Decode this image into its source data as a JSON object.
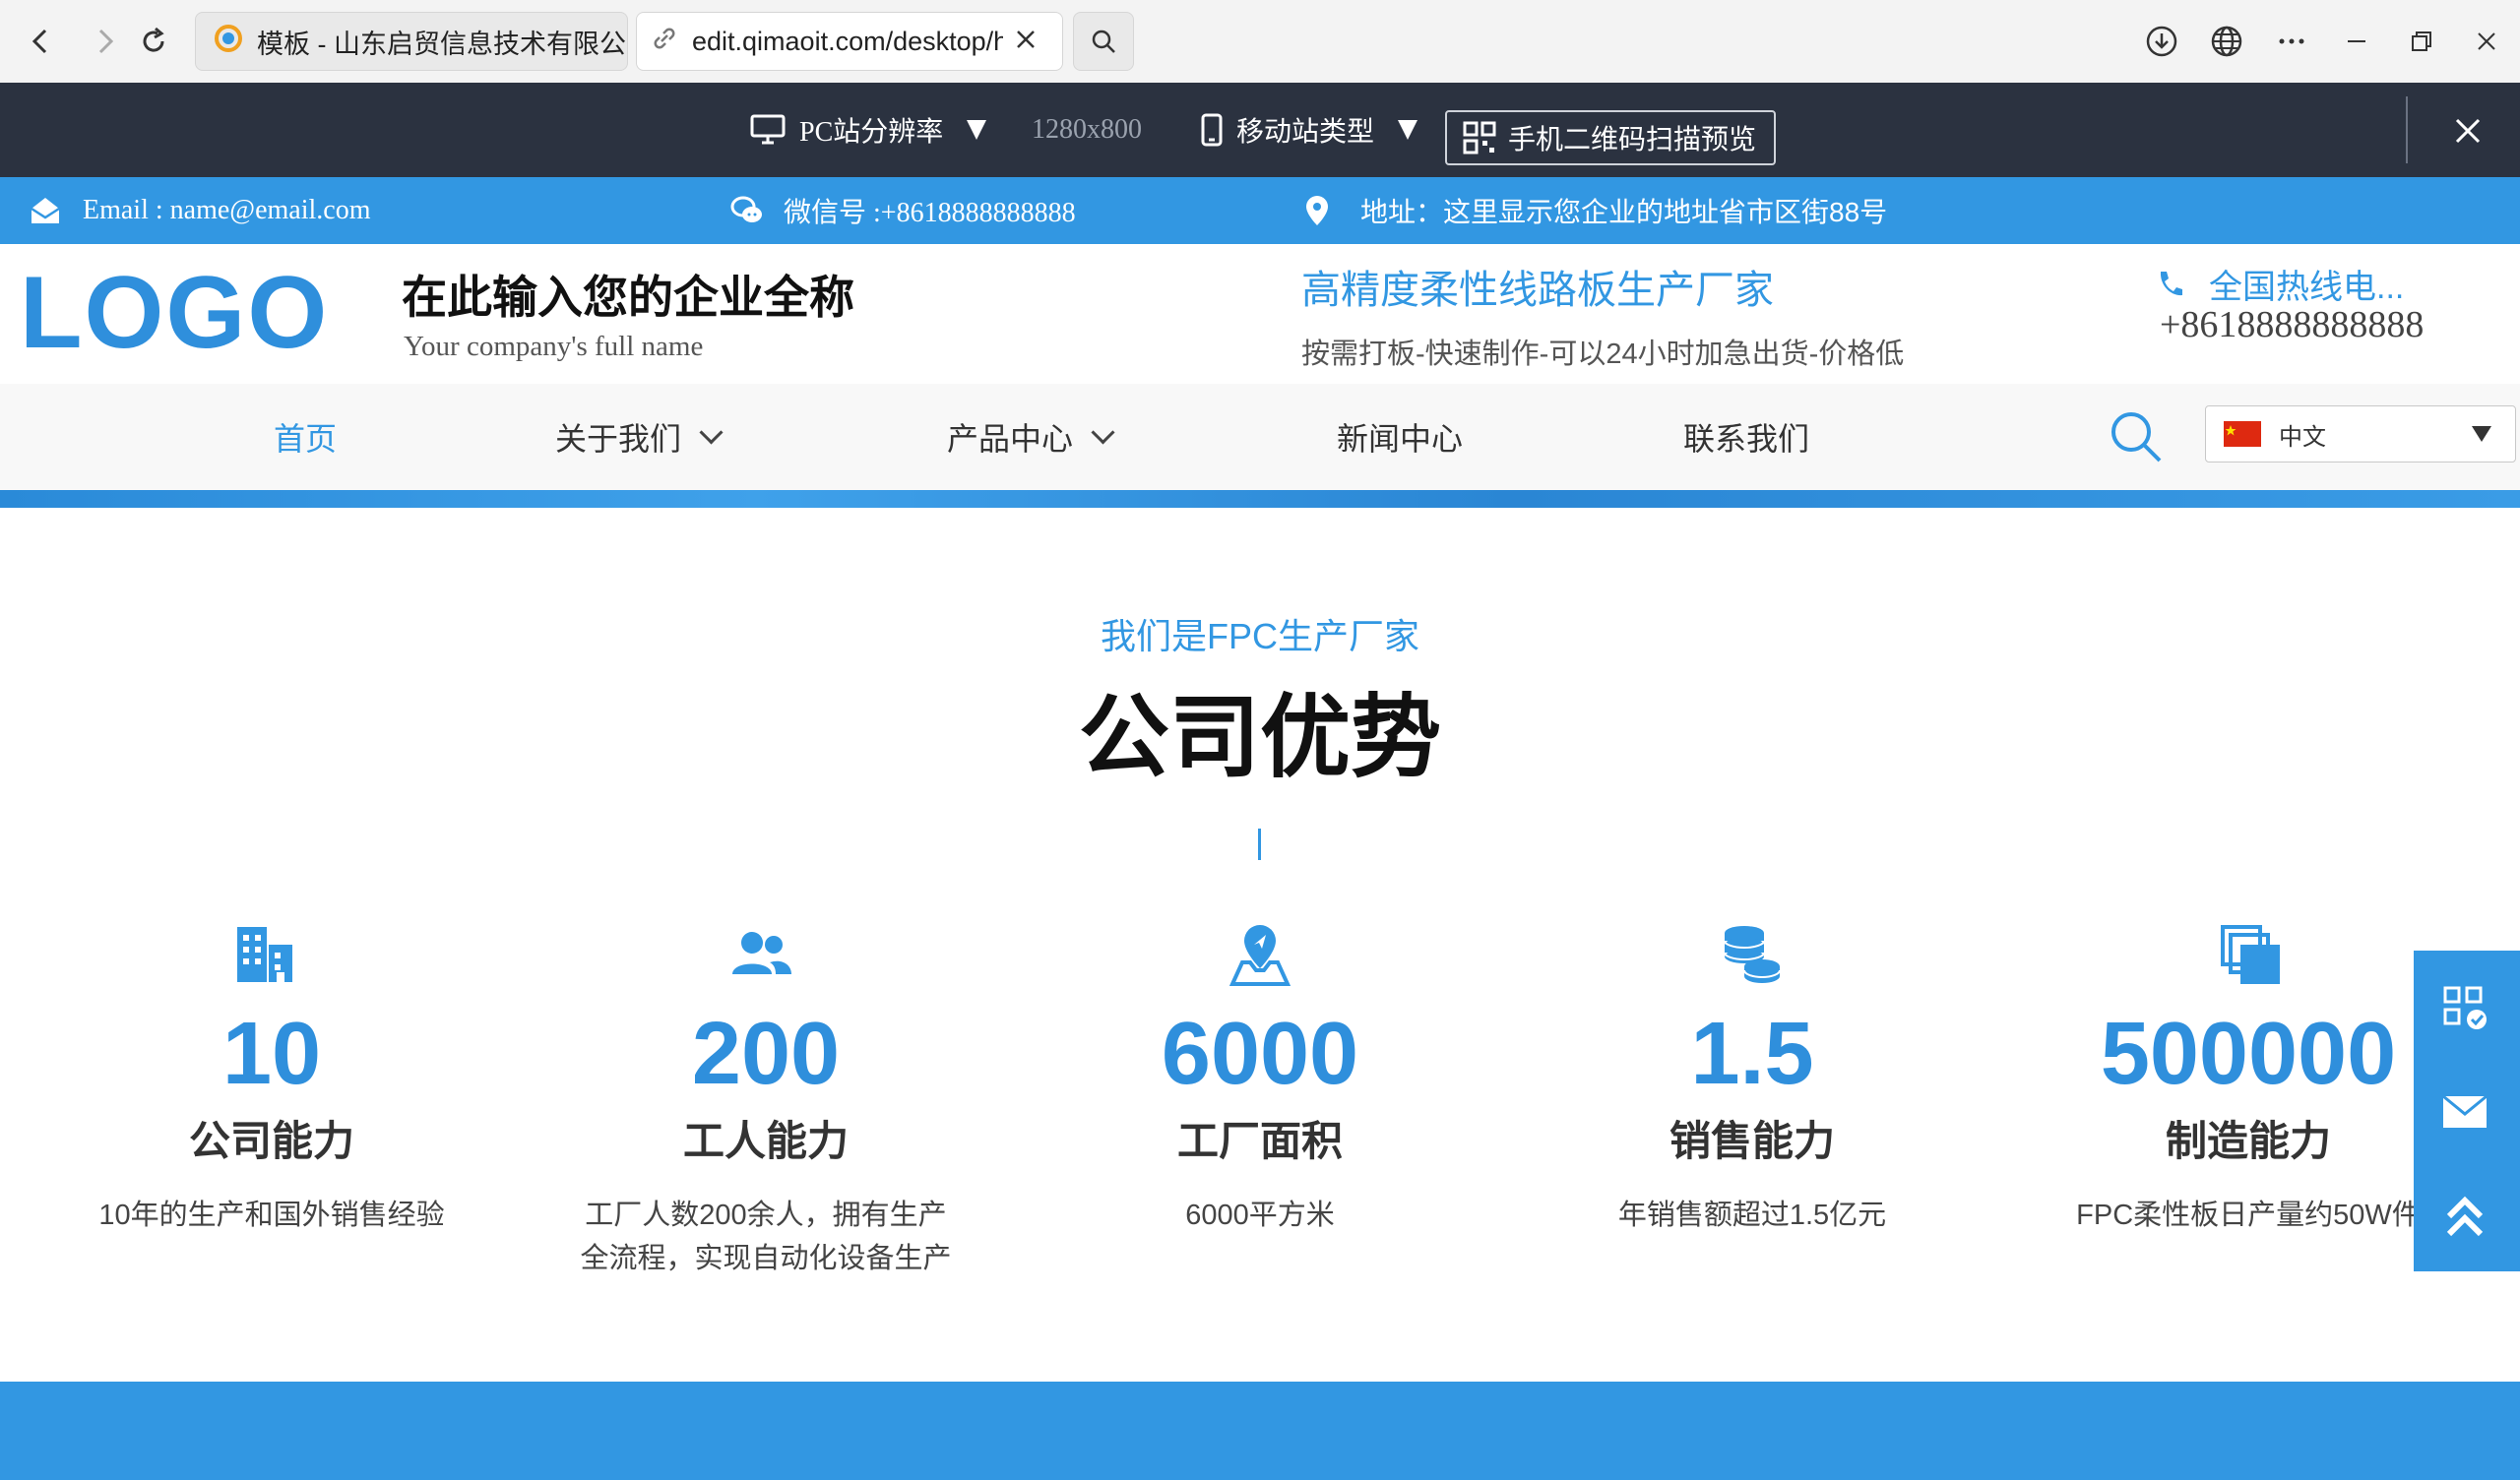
{
  "browser": {
    "tab1_title": "模板 - 山东启贸信息技术有限公司",
    "tab2_url": "edit.qimaoit.com/desktop/h"
  },
  "editor": {
    "pc_label": "PC站分辨率",
    "resolution": "1280x800",
    "mobile_label": "移动站类型",
    "qr_label": "手机二维码扫描预览"
  },
  "topinfo": {
    "email": "Email : name@email.com",
    "wechat": "微信号 :+8618888888888",
    "address": "地址：这里显示您企业的地址省市区街88号"
  },
  "header": {
    "logo": "LOGO",
    "company_cn": "在此输入您的企业全称",
    "company_en": "Your company's full name",
    "tagline": "高精度柔性线路板生产厂家",
    "subtagline": "按需打板-快速制作-可以24小时加急出货-价格低",
    "hotline_label": "全国热线电...",
    "hotline_number": "+8618888888888"
  },
  "nav": {
    "items": [
      "首页",
      "关于我们",
      "产品中心",
      "新闻中心",
      "联系我们"
    ],
    "language": "中文"
  },
  "section": {
    "subtitle": "我们是FPC生产厂家",
    "title": "公司优势"
  },
  "stats": [
    {
      "number": "10",
      "title": "公司能力",
      "desc": "10年的生产和国外销售经验",
      "icon": "building-icon"
    },
    {
      "number": "200",
      "title": "工人能力",
      "desc": "工厂人数200余人，拥有生产全流程，实现自动化设备生产",
      "icon": "users-icon"
    },
    {
      "number": "6000",
      "title": "工厂面积",
      "desc": "6000平方米",
      "icon": "map-location-icon"
    },
    {
      "number": "1.5",
      "title": "销售能力",
      "desc": "年销售额超过1.5亿元",
      "icon": "coins-icon"
    },
    {
      "number": "500000",
      "title": "制造能力",
      "desc": "FPC柔性板日产量约50W件",
      "icon": "layers-icon"
    }
  ],
  "colors": {
    "accent": "#3297e2",
    "editor_bg": "#2b3240",
    "number": "#2f8fdc"
  }
}
